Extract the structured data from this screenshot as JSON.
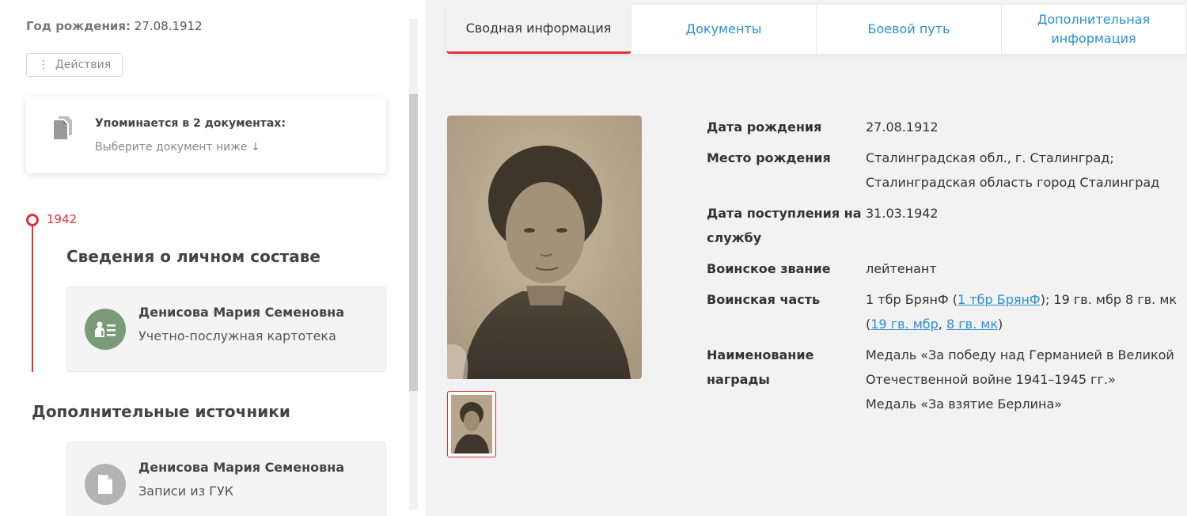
{
  "left": {
    "birth_label": "Год рождения:",
    "birth_value": "27.08.1912",
    "actions_label": "Действия",
    "mentions_title": "Упоминается в 2 документах:",
    "mentions_sub": "Выберите документ ниже ↓",
    "timeline_year": "1942",
    "section1_title": "Сведения о личном составе",
    "card1": {
      "name": "Денисова Мария Семеновна",
      "type": "Учетно-послужная картотека",
      "icon": "personnel-card-icon",
      "color": "#7a9a78"
    },
    "section2_title": "Дополнительные источники",
    "card2": {
      "name": "Денисова Мария Семеновна",
      "type": "Записи из ГУК",
      "icon": "document-icon",
      "color": "#b3b3b3"
    }
  },
  "tabs": [
    {
      "label": "Сводная информация",
      "active": true
    },
    {
      "label": "Документы",
      "active": false
    },
    {
      "label": "Боевой путь",
      "active": false
    },
    {
      "label": "Дополнительная информация",
      "active": false
    }
  ],
  "info": {
    "birth_date_label": "Дата рождения",
    "birth_date": "27.08.1912",
    "birth_place_label": "Место рождения",
    "birth_place": "Сталинградская обл., г. Сталинград; Сталинградская область город Сталинград",
    "service_start_label": "Дата поступления на службу",
    "service_start": "31.03.1942",
    "rank_label": "Воинское звание",
    "rank": "лейтенант",
    "unit_label": "Воинская часть",
    "unit": {
      "part1": "1 тбр БрянФ (",
      "link1": "1 тбр БрянФ",
      "part2": "); 19 гв. мбр 8 гв. мк (",
      "link2": "19 гв. мбр",
      "sep": ", ",
      "link3": "8 гв. мк",
      "part3": ")"
    },
    "award_label": "Наименование награды",
    "award1": "Медаль «За победу над Германией в Великой Отечественной войне 1941–1945 гг.»",
    "award2": "Медаль «За взятие Берлина»"
  },
  "colors": {
    "accent": "#e1303a",
    "link": "#2a8fd6"
  }
}
